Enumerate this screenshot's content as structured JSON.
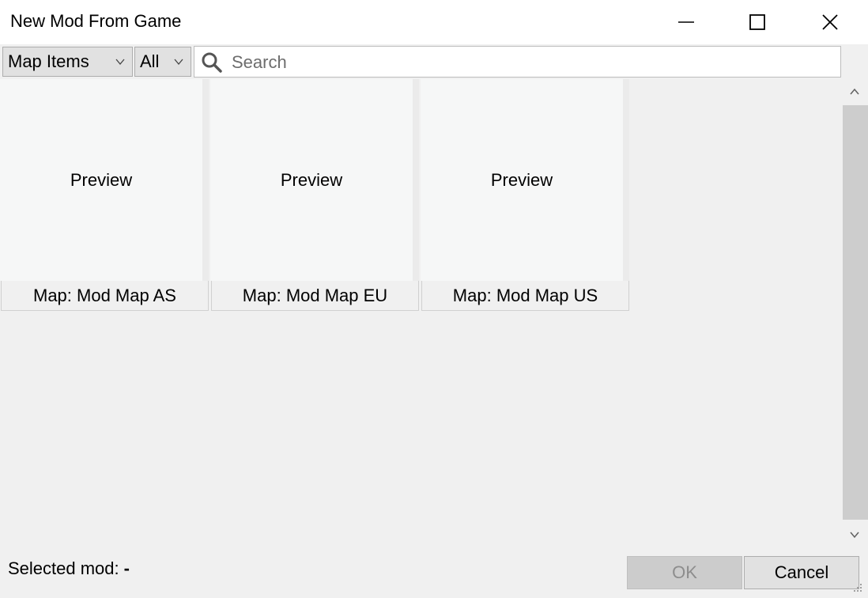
{
  "window": {
    "title": "New Mod From Game"
  },
  "toolbar": {
    "type_select": "Map Items",
    "filter_select": "All",
    "search_placeholder": "Search",
    "search_value": ""
  },
  "items": [
    {
      "preview": "Preview",
      "label": "Map: Mod Map AS"
    },
    {
      "preview": "Preview",
      "label": "Map: Mod Map EU"
    },
    {
      "preview": "Preview",
      "label": "Map: Mod Map US"
    }
  ],
  "footer": {
    "selected_label": "Selected mod:",
    "selected_value": "-",
    "ok_label": "OK",
    "cancel_label": "Cancel"
  },
  "icons": {
    "minimize": "minimize-icon",
    "maximize": "maximize-icon",
    "close": "close-icon",
    "search": "search-icon",
    "dropdown": "chevron-down-icon"
  },
  "colors": {
    "background": "#f0f0f0",
    "titlebar": "#ffffff",
    "preview_bg": "#f6f7f7",
    "disabled_button": "#cccccc"
  }
}
